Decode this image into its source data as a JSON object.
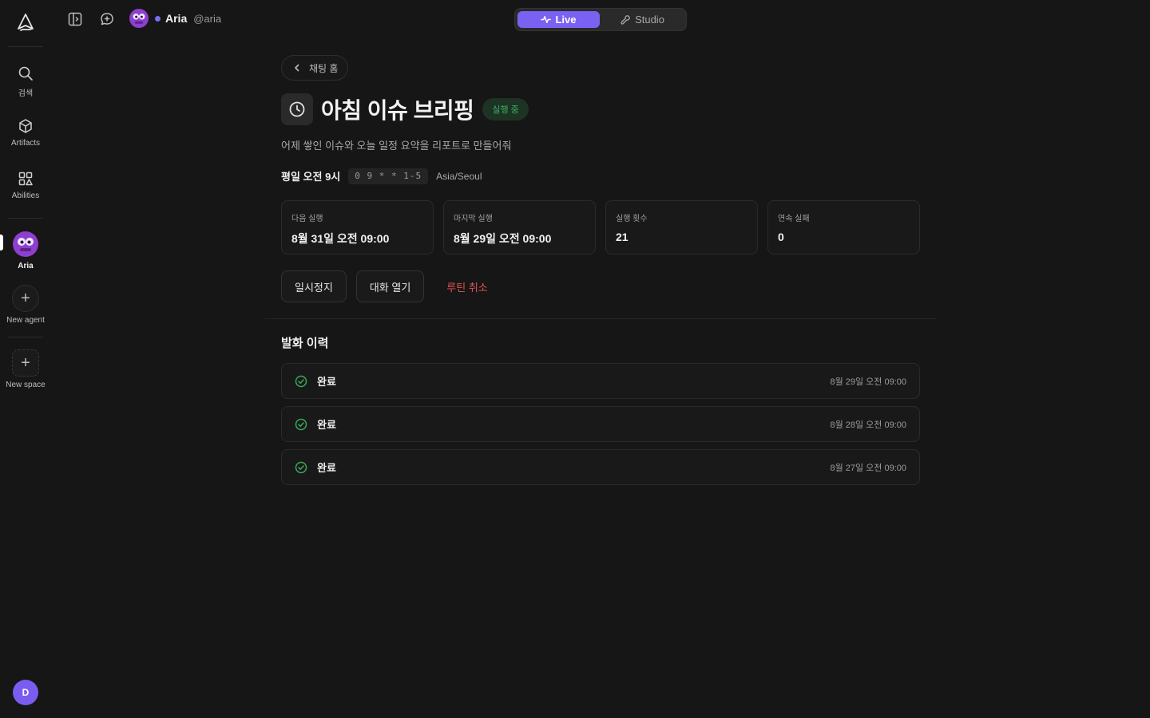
{
  "rail": {
    "items": [
      {
        "label": "검색",
        "icon": "search-icon"
      },
      {
        "label": "Artifacts",
        "icon": "box-icon"
      },
      {
        "label": "Abilities",
        "icon": "grid-icon"
      }
    ],
    "agent_label": "Aria",
    "new_agent_label": "New agent",
    "new_space_label": "New space",
    "user_initial": "D"
  },
  "topbar": {
    "agent_name": "Aria",
    "agent_handle": "@aria",
    "modes": {
      "live": "Live",
      "studio": "Studio",
      "active": "live"
    }
  },
  "main": {
    "back_label": "채팅 홈",
    "title": "아침 이슈 브리핑",
    "status": "실행 중",
    "description": "어제 쌓인 이슈와 오늘 일정 요약을 리포트로 만들어줘",
    "schedule": {
      "label": "평일 오전 9시",
      "cron": "0 9 * * 1-5",
      "timezone": "Asia/Seoul"
    },
    "stats": [
      {
        "label": "다음 실행",
        "value": "8월 31일 오전 09:00"
      },
      {
        "label": "마지막 실행",
        "value": "8월 29일 오전 09:00"
      },
      {
        "label": "실행 횟수",
        "value": "21"
      },
      {
        "label": "연속 실패",
        "value": "0"
      }
    ],
    "actions": {
      "pause": "일시정지",
      "open_chat": "대화 열기",
      "cancel": "루틴 취소"
    },
    "history_title": "발화 이력",
    "history": [
      {
        "status": "완료",
        "time": "8월 29일 오전 09:00"
      },
      {
        "status": "완료",
        "time": "8월 28일 오전 09:00"
      },
      {
        "status": "완료",
        "time": "8월 27일 오전 09:00"
      }
    ]
  },
  "colors": {
    "accent": "#7b61f2",
    "success": "#3fae5f",
    "danger": "#e25454",
    "agent": "#8e3fd0"
  }
}
